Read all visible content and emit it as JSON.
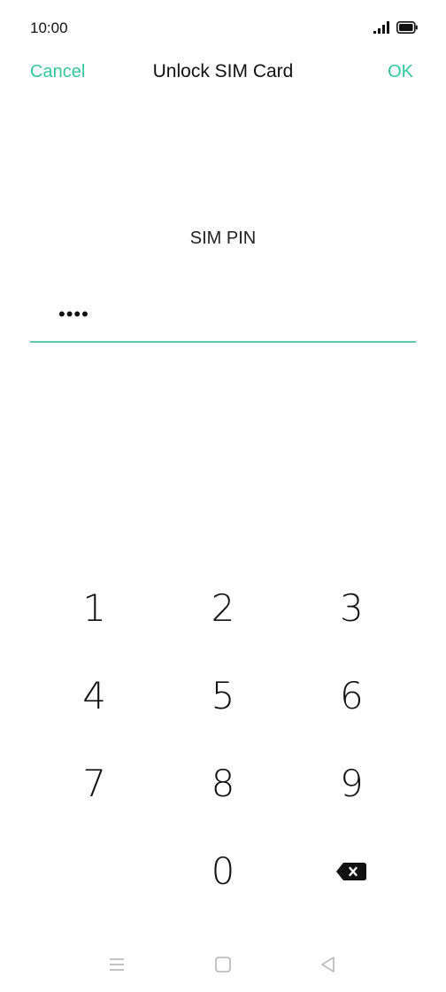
{
  "status_bar": {
    "time": "10:00",
    "icons": [
      "signal-icon",
      "battery-icon"
    ]
  },
  "header": {
    "cancel_label": "Cancel",
    "title": "Unlock SIM Card",
    "ok_label": "OK"
  },
  "pin": {
    "label": "SIM PIN",
    "value": "••••"
  },
  "keypad": {
    "rows": [
      [
        "1",
        "2",
        "3"
      ],
      [
        "4",
        "5",
        "6"
      ],
      [
        "7",
        "8",
        "9"
      ],
      [
        "",
        "0",
        "backspace-icon"
      ]
    ]
  },
  "nav_bar": {
    "icons": [
      "menu-icon",
      "home-icon",
      "back-icon"
    ]
  },
  "colors": {
    "accent": "#34c99a",
    "underline": "#5bc9ab",
    "text": "#111111",
    "nav_icon": "#b5b5b5"
  }
}
